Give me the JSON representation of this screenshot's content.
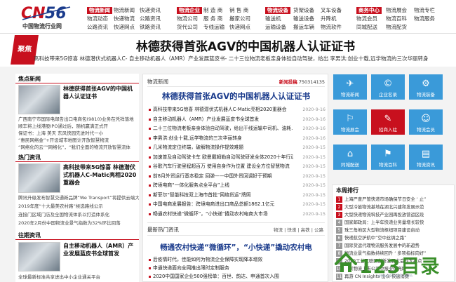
{
  "logo": {
    "mark": "CNSS",
    "net": "CN56.NET.CN",
    "subtitle": "中国物流行业网"
  },
  "nav": [
    {
      "head": "物流新闻",
      "cols": [
        [
          "物流新闻",
          "物流动态"
        ],
        [
          "快递资讯",
          "快递物流"
        ]
      ],
      "sub": [
        [
          "物流动态",
          "公路资讯"
        ],
        [
          "快递网点",
          "铁路资讯"
        ]
      ]
    },
    {
      "head": "物流企业",
      "cols": [
        [
          "制 造 商",
          "服 务 商"
        ]
      ],
      "sub": [
        [
          "企业招聘",
          "货代公司"
        ],
        [
          "快递网点",
          "专线运输"
        ]
      ]
    },
    {
      "head": "物流设备",
      "cols": [
        [
          "货架货架",
          "输送机"
        ]
      ],
      "sub": [
        [
          "叉车设备",
          "仓储设备"
        ],
        [
          "物流软件",
          "起重设备"
        ]
      ]
    }
  ],
  "nav_raw": {
    "g1": {
      "head": "物流新闻",
      "links": [
        "物流新闻",
        "快递资讯",
        "快递物流",
        "物流动态",
        "公路资讯",
        "快递网点",
        "公路资讯",
        "快递网点",
        "铁路资讯"
      ]
    },
    "g2": {
      "head": "物流企业",
      "links": [
        "制 造 商",
        "销 售 商",
        "物流公司",
        "物流企业",
        "服 务 商",
        "搬家公司",
        "货代公司",
        "专线运输",
        "快递网点"
      ]
    },
    "g3": {
      "head": "物流设备",
      "links": [
        "货架设备",
        "叉车设备",
        "物流机器人",
        "输送机",
        "输送设备",
        "升降机",
        "运输设备",
        "搬运车辆",
        "物流软件"
      ]
    },
    "g4": {
      "head": "商务中心",
      "links": [
        "物流展会",
        "物流专栏",
        "物流会员",
        "物流百科",
        "同城配送",
        "物流服务",
        "物流配货"
      ]
    }
  },
  "banner": {
    "tag": "聚焦",
    "title": "林德获得首张AGV的中国机器人认证证书",
    "subs": [
      "高科技带来5G惊喜 林德潜伏式机器人C-",
      "自主移动机器人（AMR）产业发展蓝皮书-",
      "二十三位物流老板亲身体验自动驾驶，给出",
      "李男洪:创业十载,远学物流的三次华丽转身"
    ]
  },
  "left": {
    "focus_title": "焦点新闻",
    "focus_caption": "林德获得首张AGV的中国机器人认证证书",
    "focus_items": [
      "广西南宁市国际电邮告出口电商包(9810)业务在凭祥落地",
      "顺丰将上线港股IPO通过后，随机赢满正式开",
      "保证书：上海 美天 东风快园先进时代一小",
      "“惠民网络金”+开设城市地图计开放智慧物流",
      "“网络化的云”“网络化”，“我们全面的物流开放智慧流体"
    ],
    "hot_title": "热门资讯",
    "hot_caption": "高科技带来5G惊喜 林德潜伏式机器人C-Matic亮相2020重器会",
    "hot_items": [
      "腾讯升级发布智慧交通新品牌“We Transport”将提供云端大",
      "2019年度“十大最美农村路”候选路线公示",
      "连接门区域门店及全国物流体系以打造体系化",
      "2020年2月份中国物流业景气指数为32%环比回落"
    ],
    "past_title": "往期资讯",
    "past_caption": "自主移动机器人（AMR）产业发展蓝皮书全球首发",
    "past_items": [
      "全球最新标准共享进出中小企业通关平台"
    ]
  },
  "center": {
    "tab": "物流新闻",
    "hotline_label": "新闻投稿",
    "hotline_num": "750314135",
    "headline": "林德获得首张AGV的中国机器人认证证书",
    "news": [
      {
        "t": "高科技带来5G惊喜 林德潜伏式机器人C-Matic亮相2020重器会",
        "d": "2020-9-16"
      },
      {
        "t": "自主移动机器人（AMR）产业发展蓝皮书全球首发",
        "d": "2020-9-16"
      },
      {
        "t": "二十三位物流老板亲身体验自动驾驶，给出干线运输中司机、油耗…",
        "d": "2020-9-16"
      },
      {
        "t": "李男洪:创业十载,远学物流的三次华丽转身",
        "d": "2020-9-16"
      },
      {
        "t": "几米物流定位终端，破解物流操作提效难题",
        "d": "2020-9-15"
      },
      {
        "t": "加速普及自动驾驶卡车 欧曼戴姆勒自动驾驶研发全体2020十年行动",
        "d": "2020-9-15"
      },
      {
        "t": "谷歌汽车行驶里程超百万 使用自身作为位置 建设全方位智慧物流",
        "d": "2020-9-15"
      },
      {
        "t": "前8月外贸运行基本稳定 回弹——中国外贸回调好于预期",
        "d": "2020-9-15"
      },
      {
        "t": "跨境电商“一体化服务点全平台”上线",
        "d": "2020-9-15"
      },
      {
        "t": "斯菲尔“智能科技双上海市首批“网络货运”牌照",
        "d": "2020-9-15"
      },
      {
        "t": "中国电商发展报告：跨境电商进出口商品总额1862.1亿元",
        "d": "2020-9-15"
      },
      {
        "t": "畅通农村快递“微循环”，“小快递”撬动农村电商大市场",
        "d": "2020-9-15"
      }
    ],
    "latest_title": "最新热门资讯",
    "latest_tabs": "物流 | 快递 | 高铁 | 公路",
    "latest_headline": "畅通农村快递“微循环”，“小快递”撬动农村电",
    "latest": [
      "后疫情时代，佳能如何为物流企业保障实现降本增效",
      "申通快递面向全网推出限时定制服务",
      "2020中国国家企业500强榜单：百世、韵达、申通首次入围"
    ]
  },
  "right": {
    "tiles": [
      {
        "label": "物流新闻",
        "icon": "news-icon",
        "glyph": "✈",
        "color": "#3a9ad9"
      },
      {
        "label": "企业名录",
        "icon": "company-icon",
        "glyph": "©",
        "color": "#3a9ad9"
      },
      {
        "label": "物流装备",
        "icon": "equipment-icon",
        "glyph": "⚙",
        "color": "#3a9ad9"
      },
      {
        "label": "物流展会",
        "icon": "expo-icon",
        "glyph": "⚐",
        "color": "#3a9ad9"
      },
      {
        "label": "招商入驻",
        "icon": "join-icon",
        "glyph": "✎",
        "color": "#c8101e"
      },
      {
        "label": "物流会员",
        "icon": "member-icon",
        "glyph": "☺",
        "color": "#3a9ad9"
      },
      {
        "label": "同城配送",
        "icon": "delivery-icon",
        "glyph": "⌂",
        "color": "#3a9ad9"
      },
      {
        "label": "物流百科",
        "icon": "wiki-icon",
        "glyph": "⚑",
        "color": "#3a9ad9"
      },
      {
        "label": "物流资讯",
        "icon": "info-icon",
        "glyph": "▤",
        "color": "#3a9ad9"
      }
    ],
    "rank_title": "本周排行",
    "ranks": [
      "上海严查严管快递市场确保节日安全 ‘ 止”",
      "大型冷链物流基地在湖北兴建和发展示范",
      "大型快递物流科技产业园再投放营运区段",
      "国家邮政局：上半年快递业务量增长较快",
      "珠三角地区大型物流枢纽项目建设启动",
      "快递航空护航中“空中丝绸之路”",
      "国际货运代理物流服务发展中的新趋势",
      "物流业景气指数持续回升 ‘ 多项指标向好”",
      "2020工业互联网创新发展大会四大看点",
      "两家物流上市公司中报业绩亮眼",
      "再游 CN Insights 出众 快速消费"
    ]
  },
  "watermark": {
    "text": "123目录",
    "url": "www.11223.com"
  }
}
